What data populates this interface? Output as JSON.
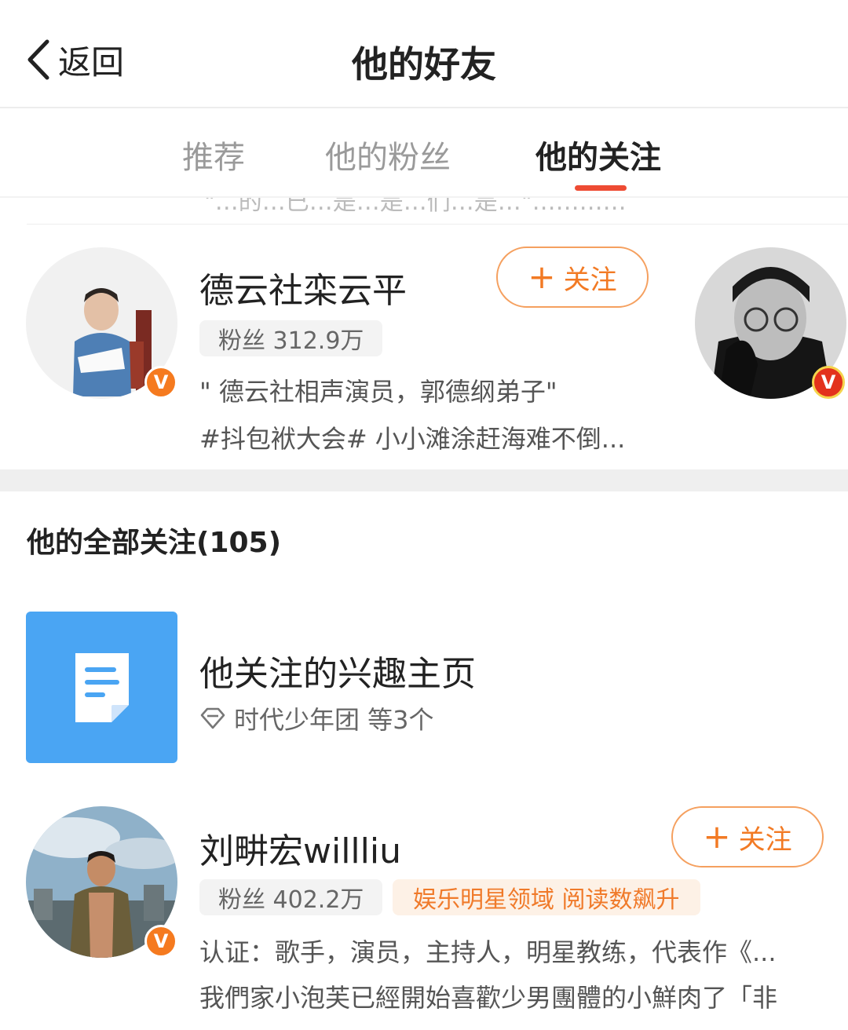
{
  "header": {
    "back_label": "返回",
    "title": "他的好友"
  },
  "tabs": [
    {
      "label": "推荐",
      "active": false
    },
    {
      "label": "他的粉丝",
      "active": false
    },
    {
      "label": "他的关注",
      "active": true
    }
  ],
  "cut_text": "\"…的…已…是…是…们…是…\"…………",
  "recommended": {
    "name": "德云社栾云平",
    "fans": "粉丝 312.9万",
    "desc_line1": "\" 德云社相声演员，郭德纲弟子\"",
    "desc_line2": "#抖包袱大会# 小小滩涂赶海难不倒...",
    "follow_label": "关注",
    "verified": "V",
    "next_verified": "V"
  },
  "section": {
    "title": "他的全部关注(105)"
  },
  "interest": {
    "title": "他关注的兴趣主页",
    "subtitle": "时代少年团 等3个"
  },
  "user2": {
    "name": "刘畊宏willliu",
    "fans": "粉丝 402.2万",
    "tag": "娱乐明星领域 阅读数飙升",
    "desc_line1": "认证：歌手，演员，主持人，明星教练，代表作《...",
    "desc_line2": "我們家小泡芙已經開始喜歡少男團體的小鮮肉了「非",
    "follow_label": "关注",
    "verified": "V"
  },
  "colors": {
    "accent_orange": "#f27a24",
    "tab_underline": "#ee4b33",
    "interest_tile": "#4aa5f3"
  },
  "icons": [
    "chevron-left-icon",
    "plus-icon",
    "document-icon",
    "diamond-icon",
    "verified-v-icon"
  ]
}
